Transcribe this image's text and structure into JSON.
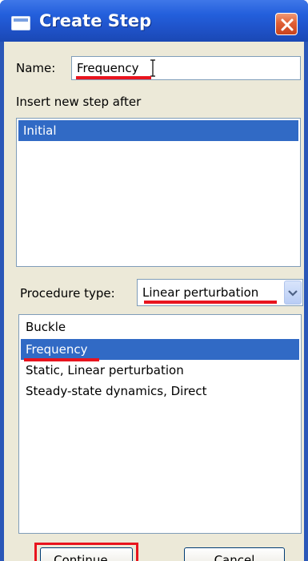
{
  "window": {
    "title": "Create Step",
    "close_icon": "close-icon"
  },
  "name": {
    "label": "Name:",
    "value": "Frequency"
  },
  "insert_after": {
    "label": "Insert new step after",
    "items": [
      {
        "label": "Initial",
        "selected": true
      }
    ]
  },
  "procedure": {
    "label": "Procedure type:",
    "selected": "Linear perturbation",
    "items": [
      {
        "label": "Buckle",
        "selected": false
      },
      {
        "label": "Frequency",
        "selected": true
      },
      {
        "label": "Static, Linear perturbation",
        "selected": false
      },
      {
        "label": "Steady-state dynamics, Direct",
        "selected": false
      }
    ]
  },
  "buttons": {
    "continue_label": "Continue...",
    "cancel_label": "Cancel"
  },
  "colors": {
    "titlebar": "#235fdc",
    "selection": "#316ac5",
    "annotation": "#e8141e",
    "dialog_bg": "#ece9d8"
  }
}
